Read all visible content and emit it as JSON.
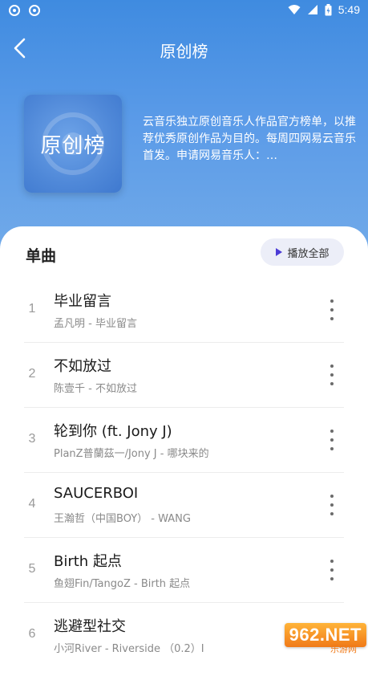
{
  "status_bar": {
    "time": "5:49"
  },
  "header": {
    "title": "原创榜",
    "cover_text": "原创榜",
    "description": "云音乐独立原创音乐人作品官方榜单，以推荐优秀原创作品为目的。每周四网易云音乐首发。申请网易音乐人：http://music.163.com…"
  },
  "panel": {
    "section_title": "单曲",
    "play_all_label": "播放全部"
  },
  "songs": [
    {
      "index": "1",
      "title": "毕业留言",
      "subtitle": "孟凡明 - 毕业留言"
    },
    {
      "index": "2",
      "title": "不如放过",
      "subtitle": "陈壹千 - 不如放过"
    },
    {
      "index": "3",
      "title": "轮到你 (ft. Jony J)",
      "subtitle": "PlanZ普蘭茲一/Jony J - 哪块来的"
    },
    {
      "index": "4",
      "title": "SAUCERBOI",
      "subtitle": "王瀚哲（中国BOY） - WANG"
    },
    {
      "index": "5",
      "title": "Birth 起点",
      "subtitle": "鱼翅Fin/TangoZ - Birth 起点"
    },
    {
      "index": "6",
      "title": "逃避型社交",
      "subtitle": "小河River - Riverside （0.2）I"
    }
  ],
  "watermark": {
    "logo_text": "962.NET",
    "sub_text": "乐游网"
  },
  "colors": {
    "header_top": "#3f8be0",
    "header_bottom": "#74ace9",
    "play_icon": "#4b3bd6"
  }
}
